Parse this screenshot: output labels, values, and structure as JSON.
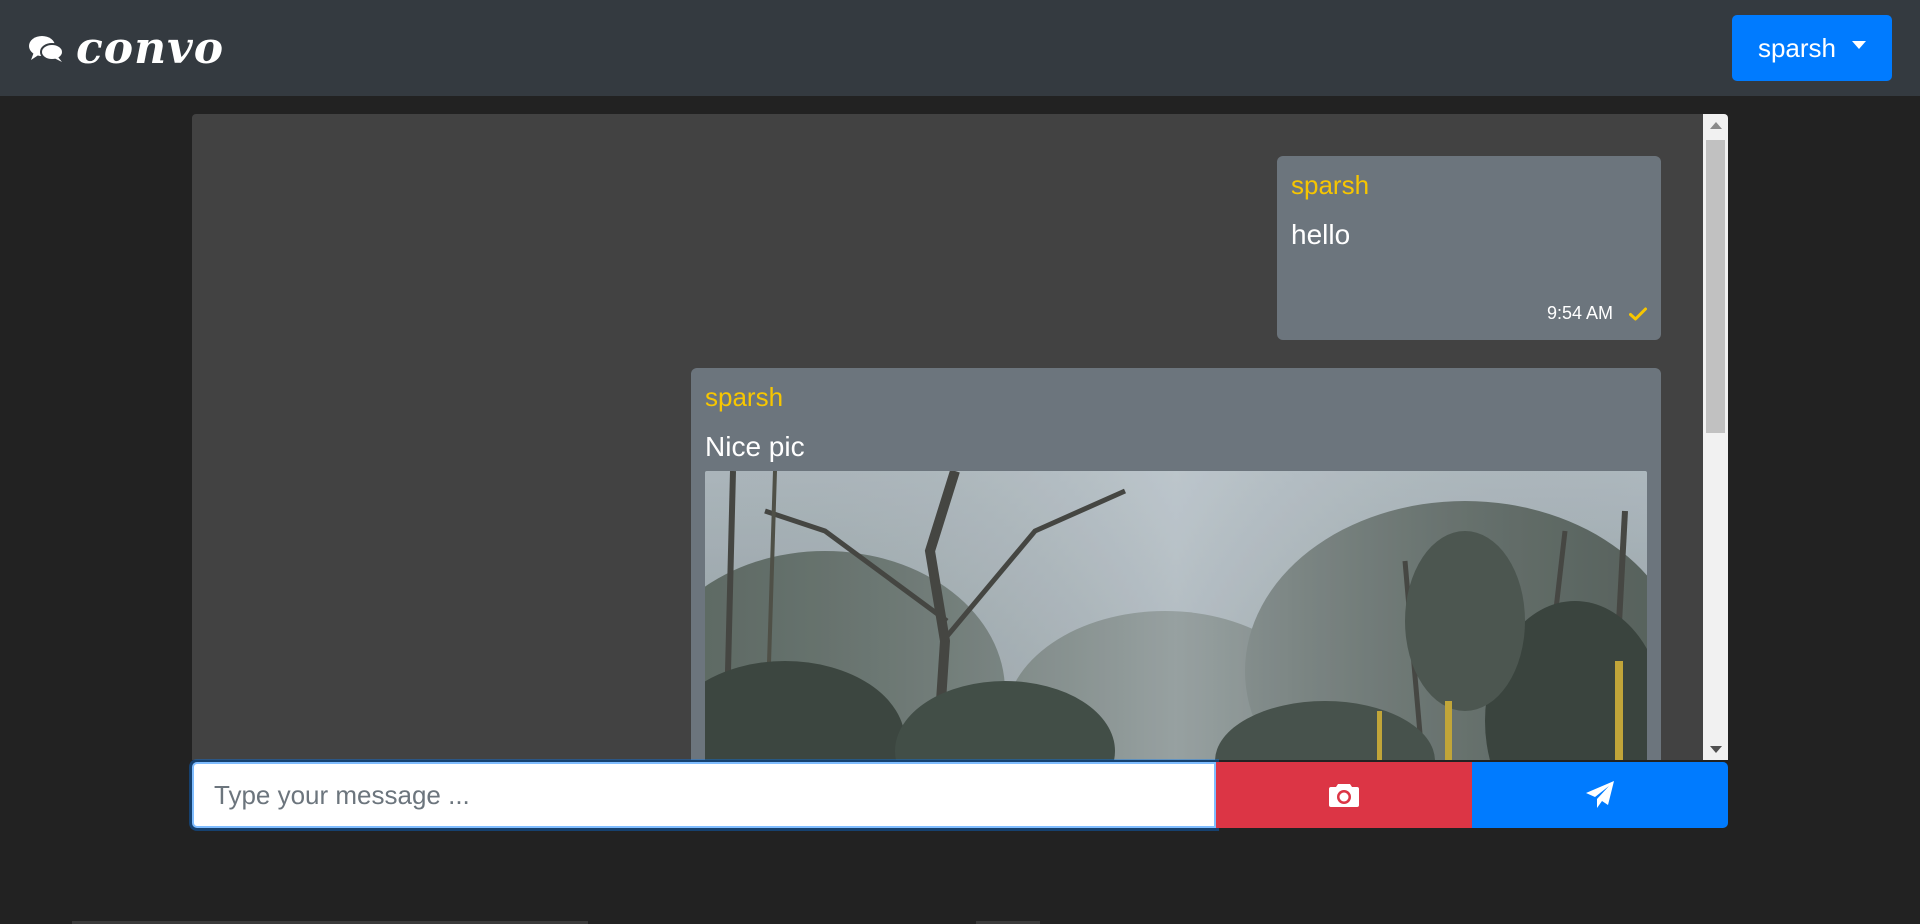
{
  "navbar": {
    "brand_name": "convo",
    "brand_icon": "comments-icon",
    "user_dropdown_label": "sparsh"
  },
  "messages": [
    {
      "sender": "sparsh",
      "text": "hello",
      "time": "9:54 AM",
      "status_icon": "check-icon"
    },
    {
      "sender": "sparsh",
      "text": "Nice pic",
      "has_image": true
    }
  ],
  "composer": {
    "placeholder": "Type your message ...",
    "camera_icon": "camera-icon",
    "send_icon": "paper-plane-icon"
  },
  "colors": {
    "navbar_bg": "#343a40",
    "page_bg": "#222222",
    "panel_bg": "#424242",
    "bubble_bg": "#6c757d",
    "sender_color": "#f7c600",
    "primary": "#007bff",
    "danger": "#dc3545"
  }
}
